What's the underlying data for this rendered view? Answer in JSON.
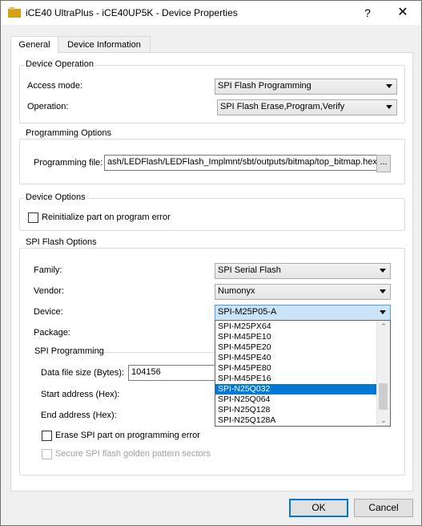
{
  "window": {
    "title": "iCE40 UltraPlus - iCE40UP5K - Device Properties",
    "help_glyph": "?",
    "close_glyph": "✕"
  },
  "tabs": [
    {
      "label": "General",
      "active": true
    },
    {
      "label": "Device Information",
      "active": false
    }
  ],
  "device_operation": {
    "title": "Device Operation",
    "access_mode_label": "Access mode:",
    "access_mode_value": "SPI Flash Programming",
    "operation_label": "Operation:",
    "operation_value": "SPI Flash Erase,Program,Verify"
  },
  "programming_options": {
    "title": "Programming Options",
    "file_label": "Programming file:",
    "file_value": "ash/LEDFlash/LEDFlash_Implmnt/sbt/outputs/bitmap/top_bitmap.hex",
    "browse_label": "..."
  },
  "device_options": {
    "title": "Device Options",
    "reinit_label": "Reinitialize part on program error",
    "reinit_checked": false
  },
  "spi_flash_options": {
    "title": "SPI Flash Options",
    "family_label": "Family:",
    "family_value": "SPI Serial Flash",
    "vendor_label": "Vendor:",
    "vendor_value": "Numonyx",
    "device_label": "Device:",
    "device_value": "SPI-M25P05-A",
    "package_label": "Package:",
    "device_list": [
      "SPI-M25PX64",
      "SPI-M45PE10",
      "SPI-M45PE20",
      "SPI-M45PE40",
      "SPI-M45PE80",
      "SPI-M45PE16",
      "SPI-N25Q032",
      "SPI-N25Q064",
      "SPI-N25Q128",
      "SPI-N25Q128A"
    ],
    "device_list_selected": "SPI-N25Q032",
    "spi_programming": {
      "title": "SPI Programming",
      "data_size_label": "Data file size (Bytes):",
      "data_size_value": "104156",
      "start_label": "Start address (Hex):",
      "end_label": "End address (Hex):",
      "erase_label": "Erase SPI part on programming error",
      "secure_label": "Secure SPI flash golden pattern sectors"
    }
  },
  "footer": {
    "ok_label": "OK",
    "cancel_label": "Cancel"
  },
  "colors": {
    "accent": "#0078d7",
    "dialog_bg": "#f0f0f0",
    "panel_bg": "#ffffff"
  }
}
